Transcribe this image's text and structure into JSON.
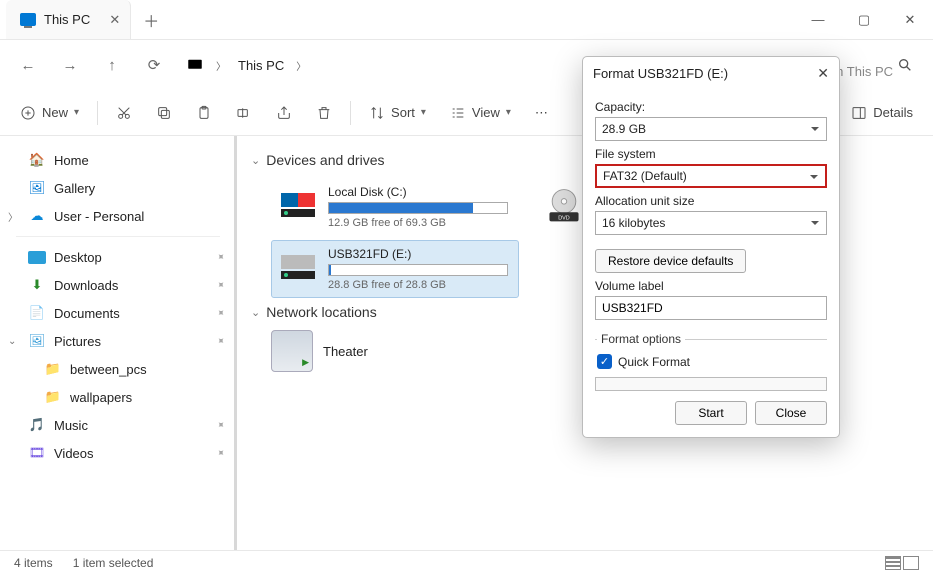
{
  "window": {
    "title_tab": "This PC"
  },
  "breadcrumb": {
    "root": "This PC"
  },
  "search": {
    "placeholder": "Search This PC"
  },
  "toolbar": {
    "new_label": "New",
    "sort_label": "Sort",
    "view_label": "View",
    "details_label": "Details"
  },
  "sidebar": {
    "home": "Home",
    "gallery": "Gallery",
    "onedrive": "User - Personal",
    "quick": {
      "desktop": "Desktop",
      "downloads": "Downloads",
      "documents": "Documents",
      "pictures": "Pictures",
      "music": "Music",
      "videos": "Videos"
    },
    "folders": {
      "between_pcs": "between_pcs",
      "wallpapers": "wallpapers"
    }
  },
  "sections": {
    "devices": "Devices and drives",
    "network": "Network locations"
  },
  "drives": {
    "c": {
      "name": "Local Disk (C:)",
      "free": "12.9 GB free of 69.3 GB",
      "fill_pct": 81
    },
    "e": {
      "name": "USB321FD (E:)",
      "free": "28.8 GB free of 28.8 GB",
      "fill_pct": 1
    },
    "dvd": {
      "name": "DVD"
    }
  },
  "netloc": {
    "theater": "Theater"
  },
  "statusbar": {
    "count": "4 items",
    "selected": "1 item selected"
  },
  "format_dialog": {
    "title": "Format USB321FD (E:)",
    "labels": {
      "capacity": "Capacity:",
      "filesystem": "File system",
      "alloc": "Allocation unit size",
      "restore": "Restore device defaults",
      "volume": "Volume label",
      "options": "Format options",
      "quick": "Quick Format",
      "start": "Start",
      "close": "Close"
    },
    "values": {
      "capacity": "28.9 GB",
      "filesystem": "FAT32 (Default)",
      "alloc": "16 kilobytes",
      "volume": "USB321FD"
    }
  }
}
